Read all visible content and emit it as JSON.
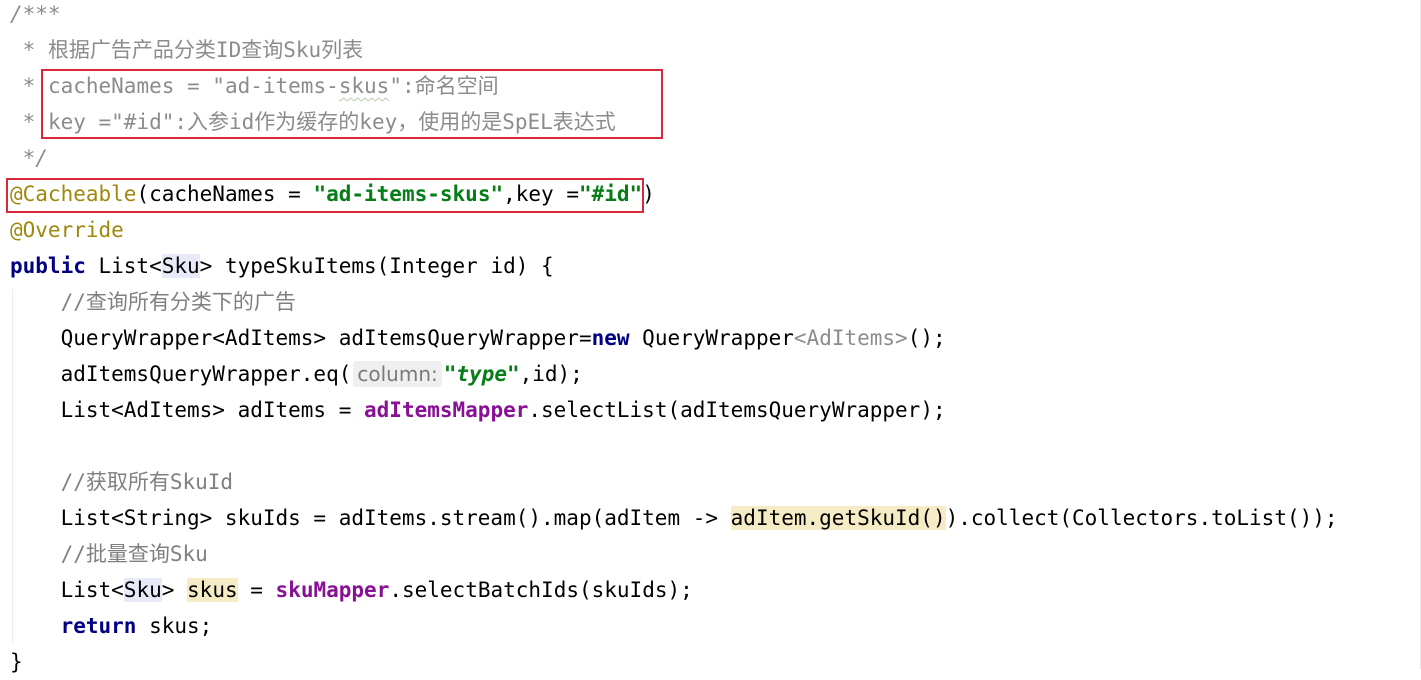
{
  "editor": {
    "lines": {
      "l1": "/***",
      "l2_star": " * ",
      "l2_text": "根据广告产品分类ID查询Sku列表",
      "l3_star": " * ",
      "l3_a": "cacheNames = \"ad-items-",
      "l3_b": "skus",
      "l3_c": "\":命名空间",
      "l4_star": " * ",
      "l4_text": "key =\"#id\":入参id作为缓存的key，使用的是SpEL表达式",
      "l5": " */",
      "l6_annot": "@Cacheable",
      "l6_a": "(cacheNames = ",
      "l6_str1": "\"ad-items-skus\"",
      "l6_b": ",key =",
      "l6_str2": "\"#id\"",
      "l6_c": ")",
      "l7": "@Override",
      "l8_kw": "public",
      "l8_a": " List<",
      "l8_sku": "Sku",
      "l8_b": "> typeSkuItems(Integer id) {",
      "l9": "    //查询所有分类下的广告",
      "l10_a": "    QueryWrapper<AdItems> adItemsQueryWrapper=",
      "l10_kw": "new",
      "l10_b": " QueryWrapper",
      "l10_dim": "<AdItems>",
      "l10_c": "();",
      "l11_a": "    adItemsQueryWrapper.eq(",
      "l11_hint": "column:",
      "l11_str": "\"type\"",
      "l11_b": ",id);",
      "l12_a": "    List<AdItems> adItems = ",
      "l12_field": "adItemsMapper",
      "l12_b": ".selectList(adItemsQueryWrapper);",
      "l14": "    //获取所有SkuId",
      "l15_a": "    List<String> skuIds = adItems.stream().map(adItem -> ",
      "l15_hl": "adItem.getSkuId()",
      "l15_b": ").collect(Collectors.toList());",
      "l16": "    //批量查询Sku",
      "l17_a": "    List<",
      "l17_sku": "Sku",
      "l17_b": "> ",
      "l17_skus": "skus",
      "l17_c": " = ",
      "l17_field": "skuMapper",
      "l17_d": ".selectBatchIds(skuIds);",
      "l18_kw": "return",
      "l18_a": " skus;",
      "l18_pre": "    ",
      "l19": "}"
    }
  }
}
